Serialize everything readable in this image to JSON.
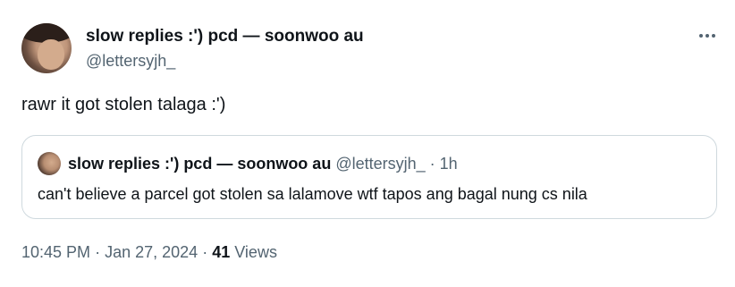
{
  "tweet": {
    "author_name": "slow replies :') pcd — soonwoo au",
    "author_handle": "@lettersyjh_",
    "text": "rawr it got stolen talaga :')",
    "more_icon": "more-horizontal-icon"
  },
  "quoted_tweet": {
    "author_name": "slow replies :') pcd — soonwoo au",
    "author_handle": "@lettersyjh_",
    "separator": "·",
    "time_ago": "1h",
    "text": "can't believe a parcel got stolen sa lalamove wtf tapos ang bagal nung cs nila"
  },
  "footer": {
    "time": "10:45 PM",
    "separator": "·",
    "date": "Jan 27, 2024",
    "separator2": "·",
    "views_count": "41",
    "views_label": "Views"
  }
}
